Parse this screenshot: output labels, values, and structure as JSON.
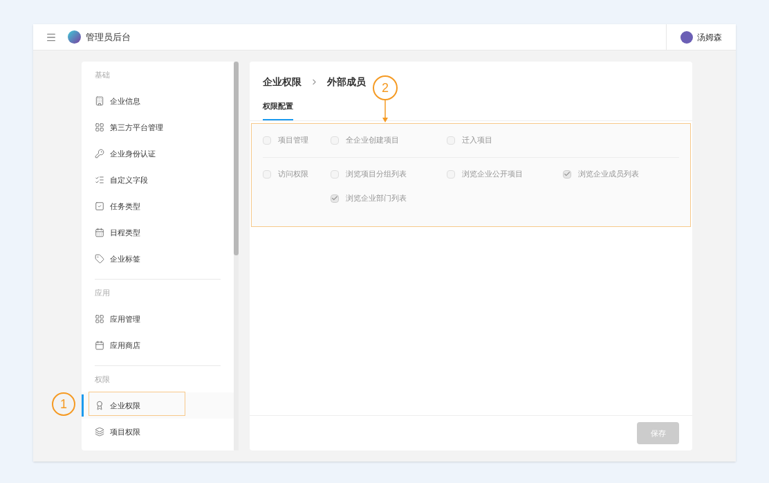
{
  "header": {
    "title": "管理员后台",
    "user": "汤姆森"
  },
  "sidebar": {
    "sections": [
      {
        "title": "基础",
        "items": [
          {
            "label": "企业信息",
            "selected": false
          },
          {
            "label": "第三方平台管理",
            "selected": false
          },
          {
            "label": "企业身份认证",
            "selected": false
          },
          {
            "label": "自定义字段",
            "selected": false
          },
          {
            "label": "任务类型",
            "selected": false
          },
          {
            "label": "日程类型",
            "selected": false
          },
          {
            "label": "企业标签",
            "selected": false
          }
        ]
      },
      {
        "title": "应用",
        "items": [
          {
            "label": "应用管理",
            "selected": false
          },
          {
            "label": "应用商店",
            "selected": false
          }
        ]
      },
      {
        "title": "权限",
        "items": [
          {
            "label": "企业权限",
            "selected": true
          },
          {
            "label": "项目权限",
            "selected": false
          }
        ]
      }
    ]
  },
  "breadcrumb": [
    "企业权限",
    "外部成员"
  ],
  "tabs": [
    {
      "label": "权限配置",
      "selected": true
    }
  ],
  "permission_groups": [
    {
      "label": "项目管理",
      "checked": false,
      "disabled": true,
      "items": [
        {
          "label": "全企业创建项目",
          "checked": false
        },
        {
          "label": "迁入项目",
          "checked": false
        }
      ]
    },
    {
      "label": "访问权限",
      "checked": false,
      "disabled": true,
      "items": [
        {
          "label": "浏览项目分组列表",
          "checked": false
        },
        {
          "label": "浏览企业公开项目",
          "checked": false
        },
        {
          "label": "浏览企业成员列表",
          "checked": true
        },
        {
          "label": "浏览企业部门列表",
          "checked": true
        }
      ]
    }
  ],
  "save_button": {
    "label": "保存",
    "disabled": true
  },
  "annotations": [
    "1",
    "2"
  ]
}
